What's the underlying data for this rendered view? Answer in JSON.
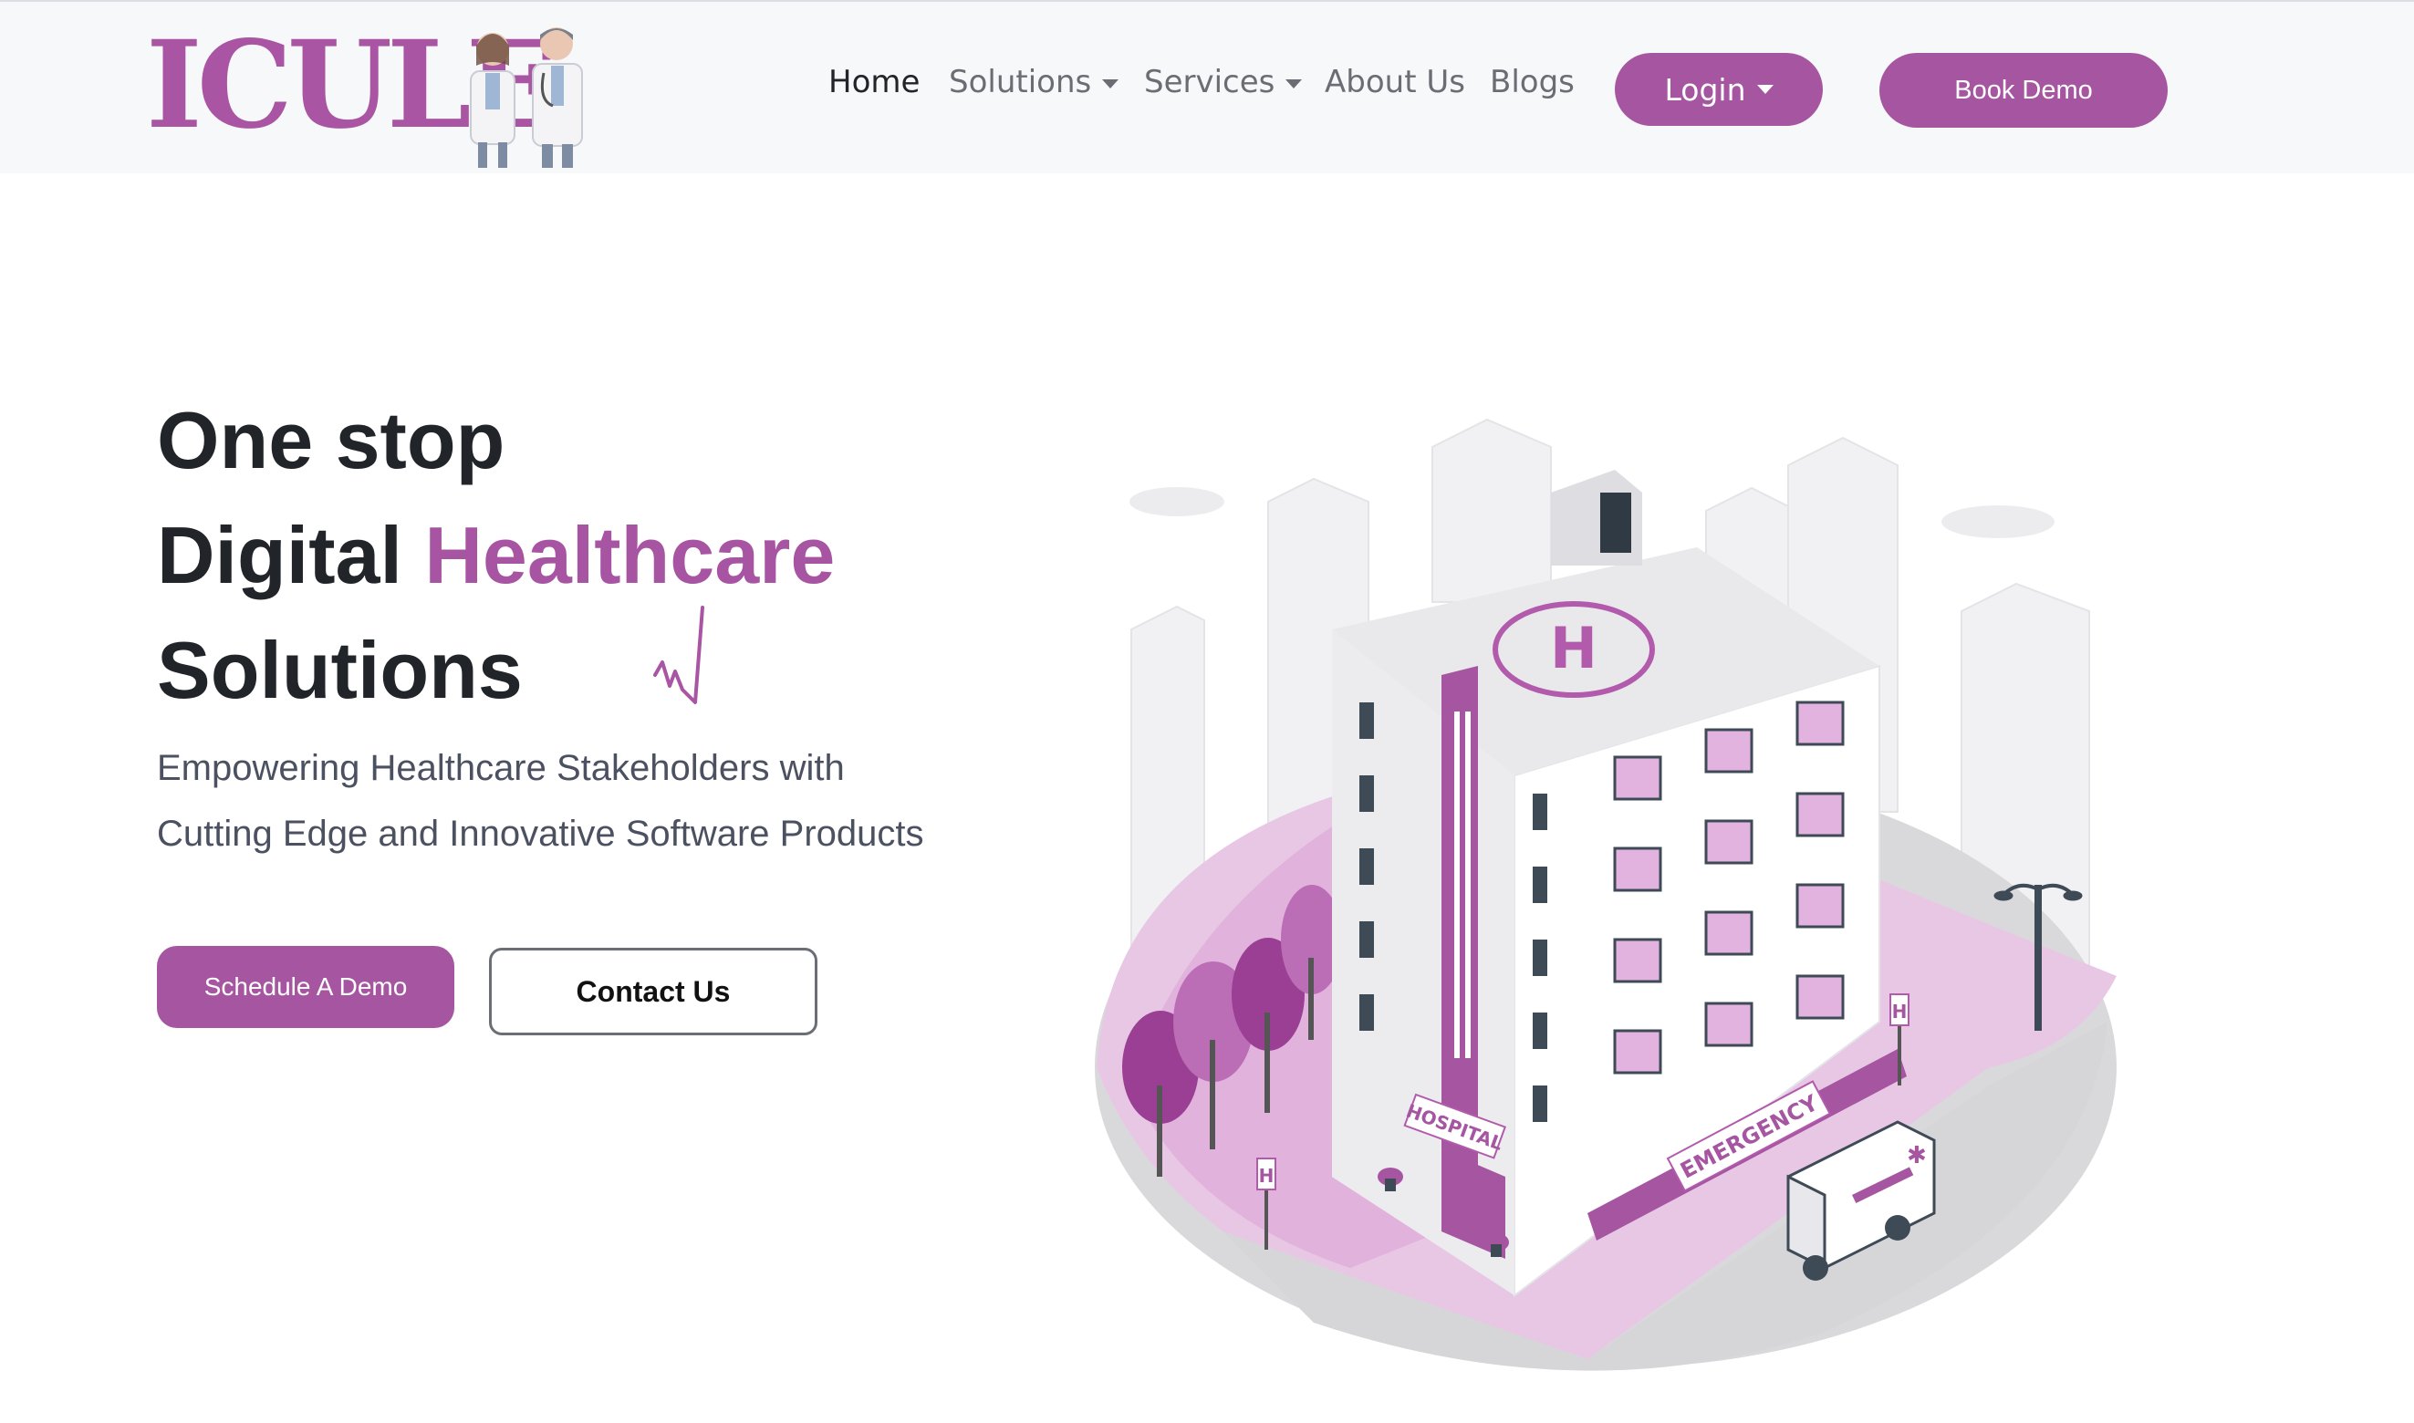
{
  "brand": {
    "name": "ICULE",
    "accent": "#a655a1",
    "logo_icon": "doctors-illustration"
  },
  "nav": {
    "items": [
      {
        "label": "Home"
      },
      {
        "label": "Solutions"
      },
      {
        "label": "Services"
      },
      {
        "label": "About Us"
      },
      {
        "label": "Blogs"
      }
    ],
    "login_label": "Login",
    "book_demo_label": "Book Demo"
  },
  "hero": {
    "title_line1": "One stop",
    "title_line2_start": "Digital",
    "title_line2_accent": "Healthcare",
    "title_line3": "Solutions",
    "subtitle_line1": "Empowering Healthcare Stakeholders with",
    "subtitle_line2": "Cutting Edge and Innovative Software Products",
    "schedule_demo_label": "Schedule A Demo",
    "contact_label": "Contact Us"
  },
  "illustration": {
    "hospital_sign": "HOSPITAL",
    "emergency_sign": "EMERGENCY",
    "helipad_letter": "H",
    "street_sign_letter": "H"
  }
}
